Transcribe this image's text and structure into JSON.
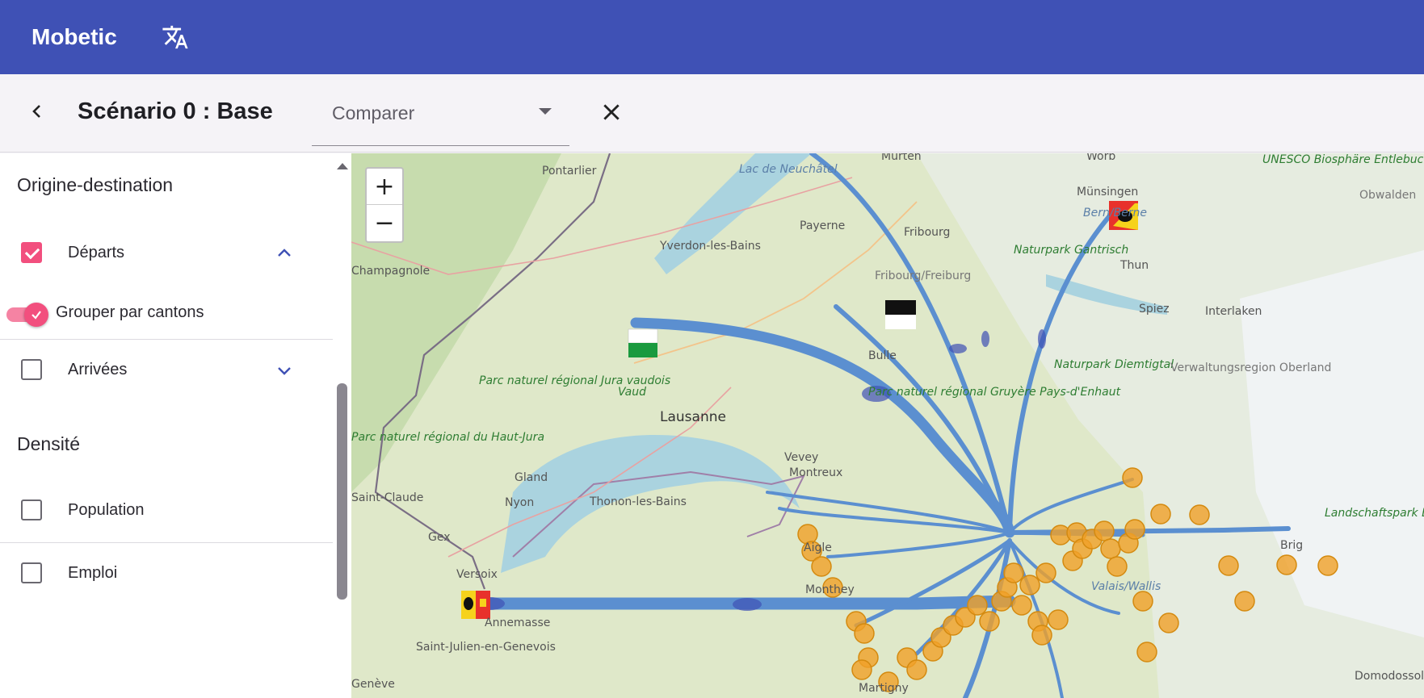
{
  "app": {
    "title": "Mobetic"
  },
  "header": {
    "scenario_title": "Scénario 0 : Base",
    "compare_placeholder": "Comparer"
  },
  "sidebar": {
    "sections": [
      {
        "title": "Origine-destination"
      },
      {
        "title": "Densité"
      }
    ],
    "items": {
      "departs": {
        "label": "Départs",
        "checked": true,
        "expanded": true
      },
      "group_by_canton": {
        "label": "Grouper par cantons",
        "on": true
      },
      "arrivees": {
        "label": "Arrivées",
        "checked": false,
        "expanded": false
      },
      "population": {
        "label": "Population",
        "checked": false
      },
      "emploi": {
        "label": "Emploi",
        "checked": false
      }
    }
  },
  "map": {
    "zoom_in": "+",
    "zoom_out": "−",
    "place_labels": [
      "Pontarlier",
      "Murten",
      "Worb",
      "Münsingen",
      "Bern/Berne",
      "UNESCO Biosphäre Entlebuch",
      "Obwalden",
      "Lac de Neuchâtel",
      "Payerne",
      "Fribourg",
      "Naturpark Gantrisch",
      "Thun",
      "Yverdon-les-Bains",
      "Champagnole",
      "Fribourg/Freiburg",
      "Spiez",
      "Interlaken",
      "Bulle",
      "Naturpark Diemtigtal",
      "Verwaltungsregion Oberland",
      "Parc naturel régional Jura vaudois",
      "Vaud",
      "Lausanne",
      "Parc naturel régional Gruyère Pays-d'Enhaut",
      "Parc naturel régional du Haut-Jura",
      "Vevey",
      "Montreux",
      "Gland",
      "Saint-Claude",
      "Nyon",
      "Thonon-les-Bains",
      "Gex",
      "Aigle",
      "Versoix",
      "Monthey",
      "Valais/Wallis",
      "Brig",
      "Landschaftspark Binntal",
      "Annemasse",
      "Saint-Julien-en-Genevois",
      "Genève",
      "Martigny",
      "Domodossola"
    ]
  }
}
